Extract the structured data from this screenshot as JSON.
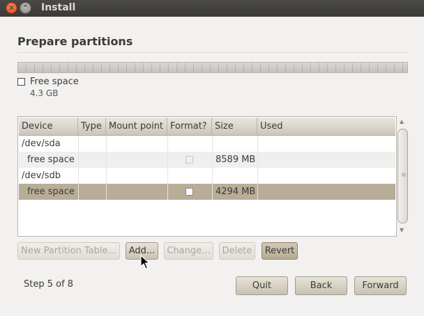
{
  "window": {
    "title": "Install"
  },
  "page": {
    "heading": "Prepare partitions"
  },
  "partition_bar": {
    "legend": {
      "label": "Free space",
      "size": "4.3 GB"
    }
  },
  "table": {
    "columns": [
      "Device",
      "Type",
      "Mount point",
      "Format?",
      "Size",
      "Used"
    ],
    "rows": [
      {
        "device": "/dev/sda",
        "type": "",
        "mount": "",
        "format": null,
        "size": "",
        "used": ""
      },
      {
        "device": "free space",
        "type": "",
        "mount": "",
        "format": false,
        "size": "8589 MB",
        "used": ""
      },
      {
        "device": "/dev/sdb",
        "type": "",
        "mount": "",
        "format": null,
        "size": "",
        "used": ""
      },
      {
        "device": "free space",
        "type": "",
        "mount": "",
        "format": false,
        "size": "4294 MB",
        "used": "",
        "selected": true
      }
    ]
  },
  "actions": {
    "new_table": "New Partition Table...",
    "add": "Add...",
    "change": "Change...",
    "delete": "Delete",
    "revert": "Revert"
  },
  "footer": {
    "step": "Step 5 of 8",
    "quit": "Quit",
    "back": "Back",
    "forward": "Forward"
  },
  "icons": {
    "close": "close-icon",
    "minimize": "minimize-icon",
    "cursor": "mouse-pointer-icon"
  },
  "colors": {
    "titlebar": "#3c3b37",
    "close_button": "#df4a16",
    "selected_row": "#b8ad97"
  }
}
